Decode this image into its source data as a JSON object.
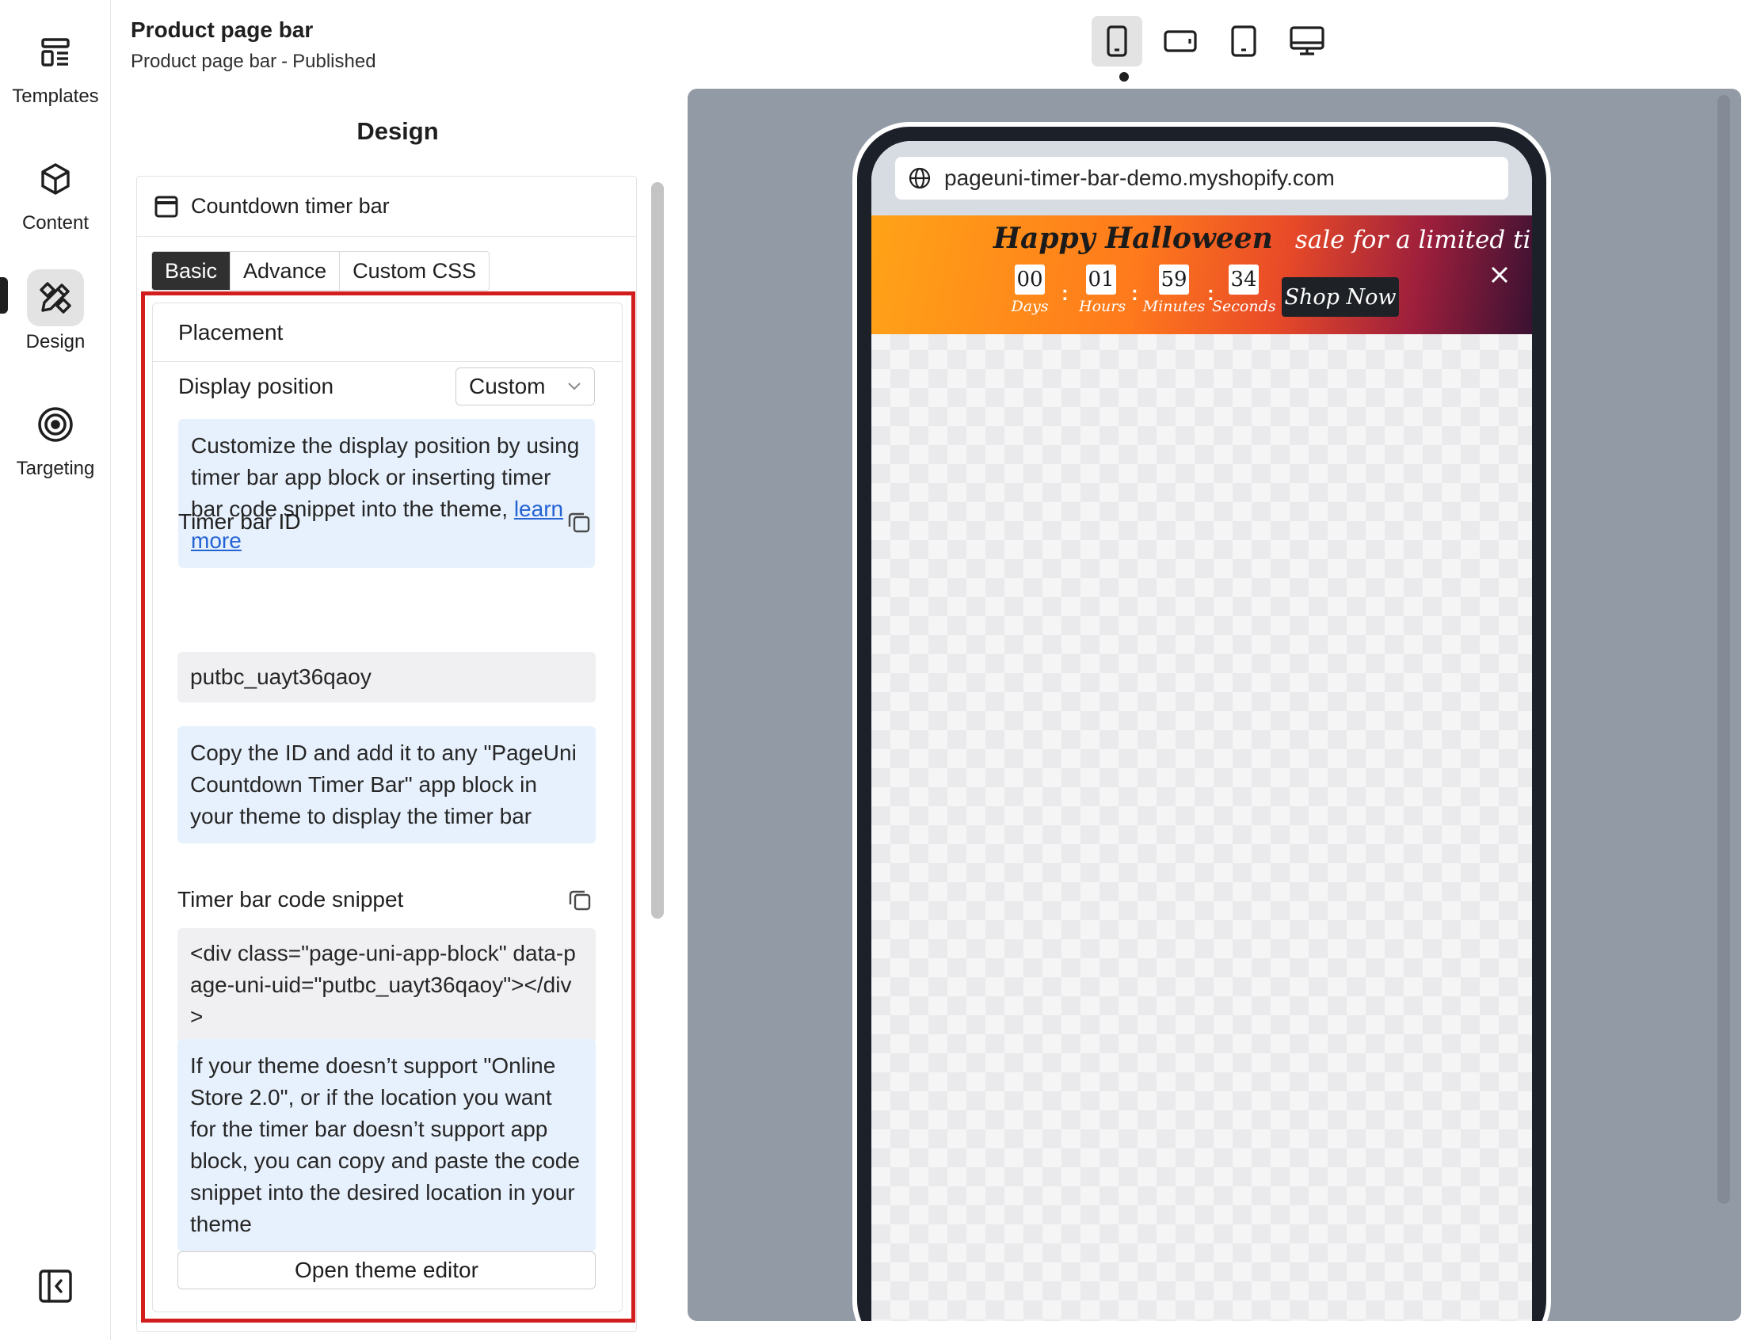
{
  "rail": {
    "items": [
      {
        "label": "Templates",
        "icon": "templates-icon"
      },
      {
        "label": "Content",
        "icon": "cube-icon"
      },
      {
        "label": "Design",
        "icon": "design-tools-icon"
      },
      {
        "label": "Targeting",
        "icon": "target-icon"
      }
    ],
    "active": "Design"
  },
  "header": {
    "title": "Product page bar",
    "name": "Product page bar",
    "separator": "-",
    "status": "Published"
  },
  "panel": {
    "heading": "Design",
    "card_title": "Countdown timer bar",
    "tabs": [
      {
        "label": "Basic",
        "active": true
      },
      {
        "label": "Advance",
        "active": false
      },
      {
        "label": "Custom CSS",
        "active": false
      }
    ],
    "section_title": "Placement",
    "display_position": {
      "label": "Display position",
      "value": "Custom"
    },
    "position_info": {
      "text": "Customize the display position by using timer bar app block or inserting timer bar code snippet into the theme,",
      "link": "learn more"
    },
    "timer_id": {
      "label": "Timer bar ID",
      "value": "putbc_uayt36qaoy",
      "info": "Copy the ID and add it to any \"PageUni Countdown Timer Bar\" app block in your theme to display the timer bar"
    },
    "snippet": {
      "label": "Timer bar code snippet",
      "value": "<div class=\"page-uni-app-block\" data-page-uni-uid=\"putbc_uayt36qaoy\"></div>",
      "info": "If your theme doesn’t support \"Online Store 2.0\", or if the location you want for the timer bar doesn’t support app block, you can copy and paste the code snippet into the desired location in your theme"
    },
    "open_editor_label": "Open theme editor"
  },
  "devices": [
    {
      "name": "mobile",
      "active": true
    },
    {
      "name": "mobile-landscape",
      "active": false
    },
    {
      "name": "tablet",
      "active": false
    },
    {
      "name": "desktop",
      "active": false
    }
  ],
  "preview": {
    "url": "pageuni-timer-bar-demo.myshopify.com",
    "banner": {
      "title": "Happy Halloween",
      "subtitle": "sale for a limited time",
      "countdown": [
        {
          "value": "00",
          "unit": "Days"
        },
        {
          "value": "01",
          "unit": "Hours"
        },
        {
          "value": "59",
          "unit": "Minutes"
        },
        {
          "value": "34",
          "unit": "Seconds"
        }
      ],
      "separator": ":",
      "button": "Shop Now"
    }
  },
  "colors": {
    "highlight_border": "#d21d1d",
    "info_bg": "#e7f1fd",
    "active_tab": "#303030",
    "preview_bg": "#929aa6",
    "banner_gradient": [
      "#ffa317",
      "#e84a28",
      "#3a1132"
    ]
  }
}
